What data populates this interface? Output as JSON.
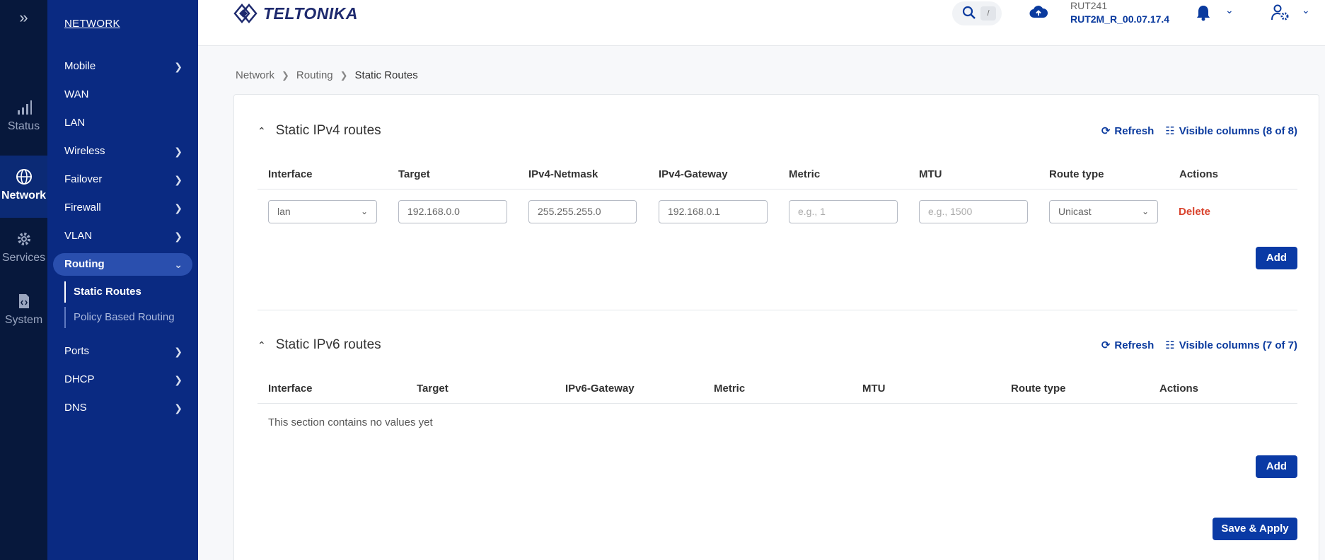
{
  "rail": {
    "expand_icon": "double-chevron-right-icon",
    "items": [
      {
        "label": "Status",
        "icon": "signal-bars-icon"
      },
      {
        "label": "Network",
        "icon": "globe-icon"
      },
      {
        "label": "Services",
        "icon": "gear-icon"
      },
      {
        "label": "System",
        "icon": "system-file-icon"
      }
    ]
  },
  "nav": {
    "heading": "NETWORK",
    "items": [
      {
        "label": "Mobile"
      },
      {
        "label": "WAN"
      },
      {
        "label": "LAN"
      },
      {
        "label": "Wireless"
      },
      {
        "label": "Failover"
      },
      {
        "label": "Firewall"
      },
      {
        "label": "VLAN"
      },
      {
        "label": "Routing"
      },
      {
        "label": "Ports"
      },
      {
        "label": "DHCP"
      },
      {
        "label": "DNS"
      }
    ],
    "routing_sub": [
      {
        "label": "Static Routes"
      },
      {
        "label": "Policy Based Routing"
      }
    ],
    "chevron_right": ">",
    "chevron_down": "v"
  },
  "header": {
    "logo": "TELTONIKA",
    "search_shortcut": "/",
    "device_name": "RUT241",
    "firmware": "RUT2M_R_00.07.17.4"
  },
  "breadcrumb": {
    "items": [
      "Network",
      "Routing",
      "Static Routes"
    ],
    "separator": ">"
  },
  "ipv4": {
    "title": "Static IPv4 routes",
    "refresh": "Refresh",
    "visible_columns": "Visible columns (8 of 8)",
    "columns": [
      "Interface",
      "Target",
      "IPv4-Netmask",
      "IPv4-Gateway",
      "Metric",
      "MTU",
      "Route type",
      "Actions"
    ],
    "row": {
      "interface": "lan",
      "target": "192.168.0.0",
      "netmask": "255.255.255.0",
      "gateway": "192.168.0.1",
      "metric_placeholder": "e.g., 1",
      "mtu_placeholder": "e.g., 1500",
      "route_type": "Unicast",
      "delete": "Delete"
    },
    "add": "Add"
  },
  "ipv6": {
    "title": "Static IPv6 routes",
    "refresh": "Refresh",
    "visible_columns": "Visible columns (7 of 7)",
    "columns": [
      "Interface",
      "Target",
      "IPv6-Gateway",
      "Metric",
      "MTU",
      "Route type",
      "Actions"
    ],
    "empty": "This section contains no values yet",
    "add": "Add"
  },
  "save_apply": "Save & Apply",
  "colors": {
    "rail_bg": "#07183c",
    "nav_bg": "#0a2a82",
    "accent": "#0a3aa5",
    "danger": "#d9442e"
  }
}
